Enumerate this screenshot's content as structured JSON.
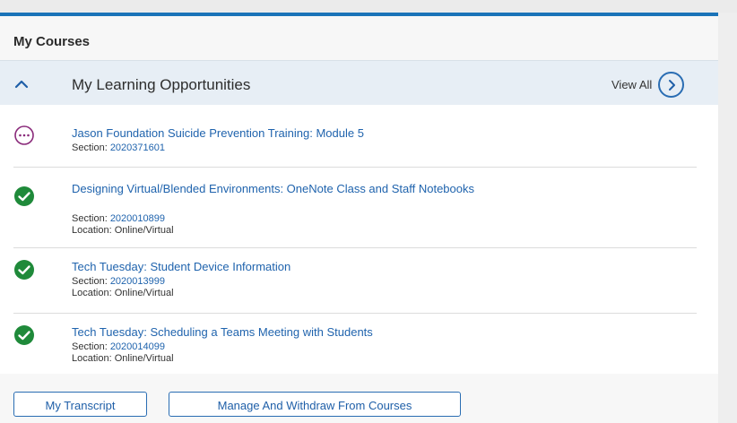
{
  "panel": {
    "title": "My Courses"
  },
  "section": {
    "title": "My Learning Opportunities",
    "view_all": "View All"
  },
  "courses": [
    {
      "status": "in-progress",
      "title": "Jason Foundation Suicide Prevention Training: Module 5",
      "section_label": "Section:",
      "section": "2020371601"
    },
    {
      "status": "completed",
      "title": "Designing Virtual/Blended Environments: OneNote Class and Staff Notebooks",
      "section_label": "Section:",
      "section": "2020010899",
      "location": "Location: Online/Virtual"
    },
    {
      "status": "completed",
      "title": "Tech Tuesday: Student Device Information",
      "section_label": "Section:",
      "section": "2020013999",
      "location": "Location: Online/Virtual"
    },
    {
      "status": "completed",
      "title": "Tech Tuesday: Scheduling a Teams Meeting with Students",
      "section_label": "Section:",
      "section": "2020014099",
      "location": "Location: Online/Virtual"
    }
  ],
  "buttons": {
    "transcript": "My Transcript",
    "manage": "Manage And Withdraw From Courses"
  },
  "colors": {
    "accent": "#1a73b8",
    "link": "#1f63ad",
    "completed": "#1f8a3a",
    "in_progress": "#8a2a7a"
  },
  "icons": {
    "collapse": "chevron-up-icon",
    "view_all": "chevron-right-circle-icon",
    "completed": "checkmark-circle-icon",
    "in_progress": "ellipsis-circle-icon"
  }
}
